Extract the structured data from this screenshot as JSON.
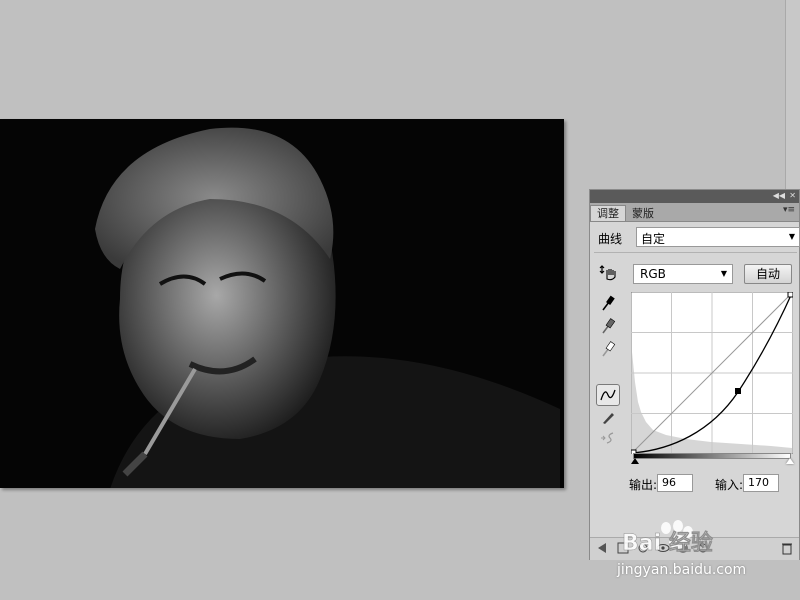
{
  "panel": {
    "tabs": [
      "调整",
      "蒙版"
    ],
    "curves_label": "曲线",
    "preset_value": "自定",
    "channel_value": "RGB",
    "auto_button": "自动",
    "output_label": "输出:",
    "output_value": "96",
    "input_label": "输入:",
    "input_value": "170"
  },
  "watermark": {
    "text": "Bai 经验",
    "url": "jingyan.baidu.com"
  },
  "colors": {
    "workspace": "#c0c0c0",
    "panel_bg": "#d6d6d6",
    "canvas_bg": "#050505"
  }
}
